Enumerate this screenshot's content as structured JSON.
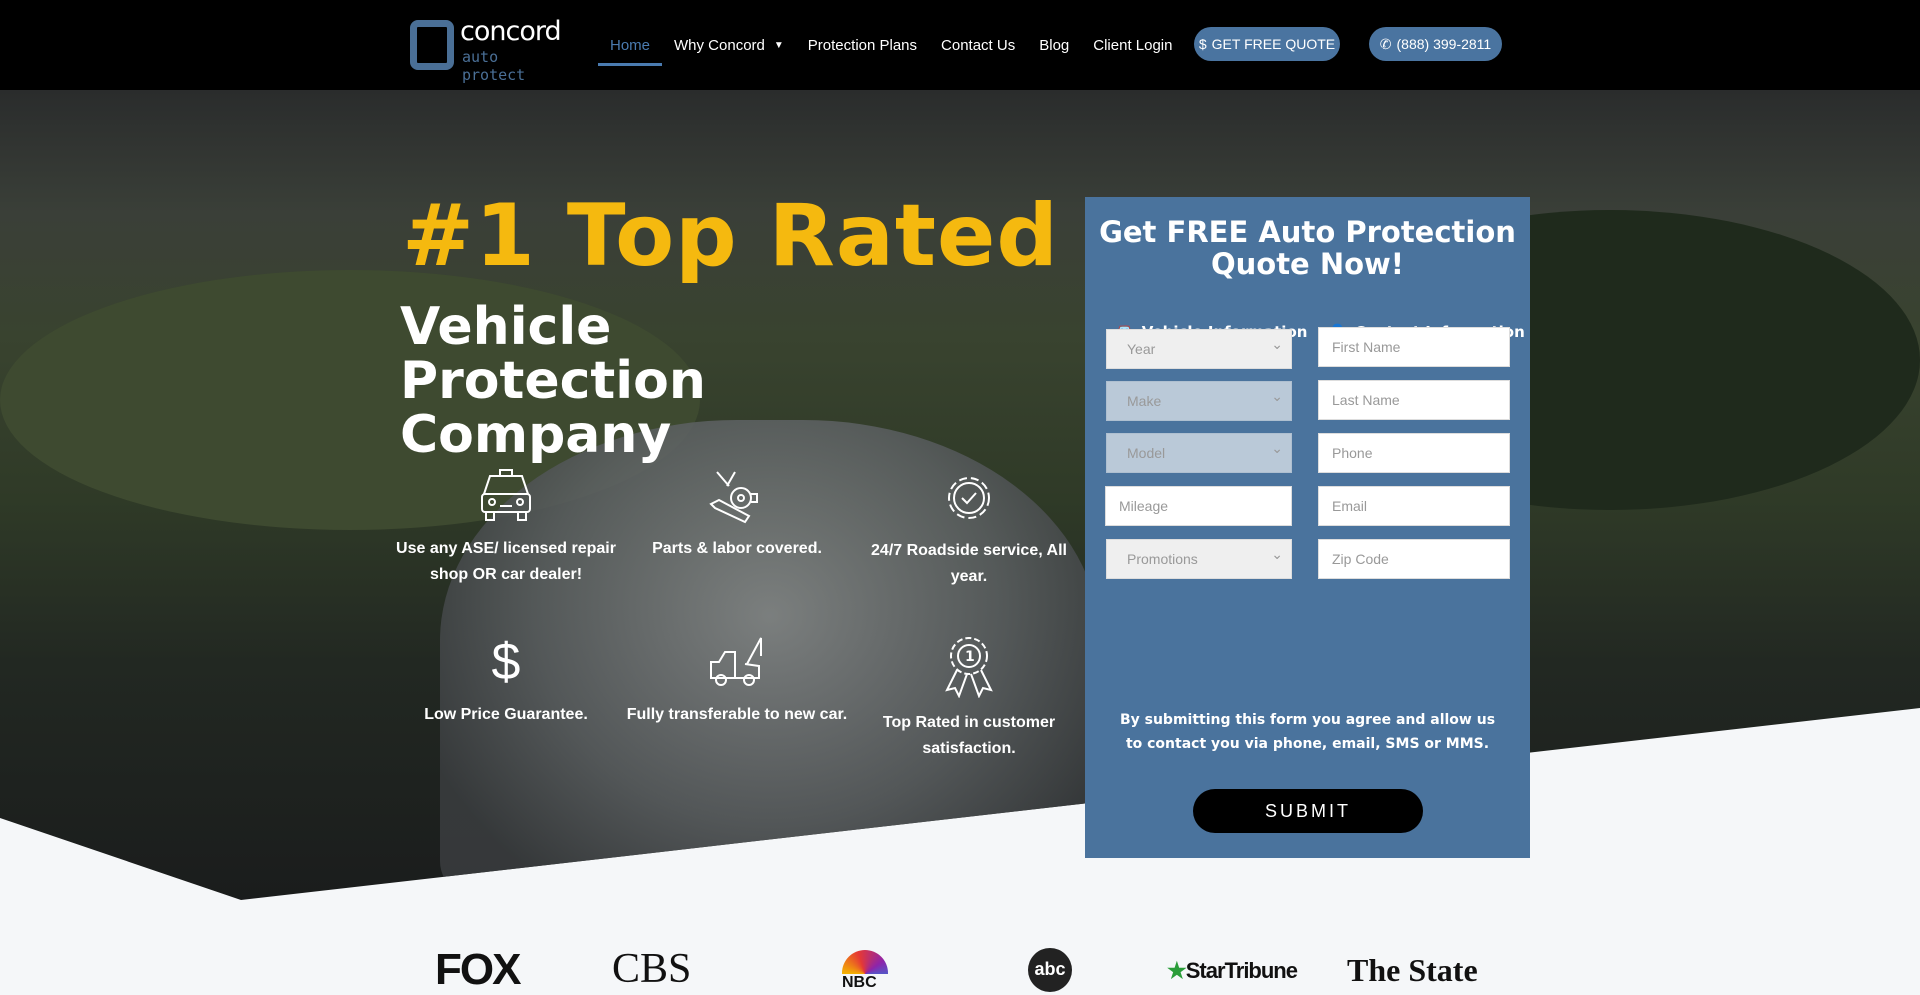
{
  "header": {
    "logo": {
      "word1": "concord",
      "word2": "auto protect"
    },
    "nav": [
      {
        "label": "Home",
        "active": true
      },
      {
        "label": "Why Concord",
        "dropdown": true
      },
      {
        "label": "Protection Plans"
      },
      {
        "label": "Contact Us"
      },
      {
        "label": "Blog"
      },
      {
        "label": "Client Login"
      }
    ],
    "quote_button": "GET FREE QUOTE",
    "phone_button": "(888) 399-2811"
  },
  "hero": {
    "headline": "#1 Top Rated",
    "subheadline": "Vehicle Protection Company",
    "features": [
      {
        "icon": "taxi-car-icon",
        "text": "Use any ASE/ licensed repair shop OR car dealer!"
      },
      {
        "icon": "engine-wrench-icon",
        "text": "Parts & labor covered."
      },
      {
        "icon": "gear-check-icon",
        "text": "24/7 Roadside service, All year."
      },
      {
        "icon": "dollar-icon",
        "text": "Low Price Guarantee."
      },
      {
        "icon": "tow-truck-icon",
        "text": "Fully transferable to new car."
      },
      {
        "icon": "award-ribbon-icon",
        "text": "Top Rated in customer satisfaction."
      }
    ]
  },
  "form": {
    "title": "Get FREE Auto Protection Quote Now!",
    "vehicle_heading": "Vehicle Information",
    "contact_heading": "Contact Information",
    "vehicle_fields": [
      {
        "placeholder": "Year",
        "type": "select"
      },
      {
        "placeholder": "Make",
        "type": "select",
        "disabled": true
      },
      {
        "placeholder": "Model",
        "type": "select",
        "disabled": true
      },
      {
        "placeholder": "Mileage",
        "type": "input"
      },
      {
        "placeholder": "Promotions",
        "type": "select"
      }
    ],
    "contact_fields": [
      "First Name",
      "Last Name",
      "Phone",
      "Email",
      "Zip Code"
    ],
    "consent": "By submitting this form you agree and allow us to contact you via phone, email, SMS or MMS.",
    "submit": "SUBMIT"
  },
  "media_logos": [
    "FOX",
    "CBS",
    "NBC",
    "abc",
    "StarTribune",
    "The State"
  ],
  "colors": {
    "accent": "#4a739d",
    "headline": "#f5b90f",
    "header_bg": "#000000"
  }
}
